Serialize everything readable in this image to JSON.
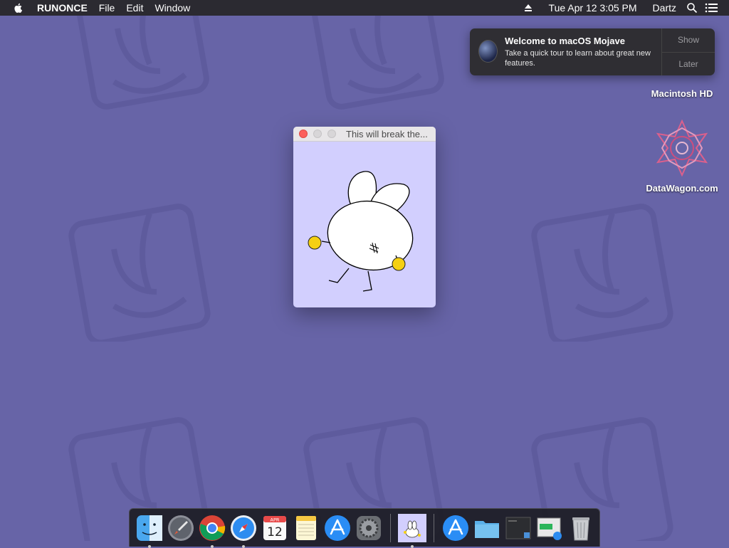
{
  "menubar": {
    "app_name": "RUNONCE",
    "menus": [
      "File",
      "Edit",
      "Window"
    ],
    "datetime": "Tue Apr 12  3:05 PM",
    "user": "Dartz"
  },
  "notification": {
    "title": "Welcome to macOS Mojave",
    "message": "Take a quick tour to learn about great new features.",
    "show_label": "Show",
    "later_label": "Later"
  },
  "desktop_icons": [
    "Macintosh HD",
    "DataWagon.com"
  ],
  "window": {
    "title": "This will break the..."
  },
  "dock": {
    "calendar_month": "APR",
    "calendar_day": "12",
    "apps": [
      "Finder",
      "Launchpad",
      "Chrome",
      "Safari",
      "Calendar",
      "Notes",
      "App Store",
      "System Preferences",
      "RUNONCE",
      "App Store",
      "Documents",
      "Screenshot",
      "Downloads",
      "Trash"
    ]
  },
  "colors": {
    "wallpaper": "#6764a7",
    "window_bg": "#d2cffe",
    "menubar": "#2b2a31"
  }
}
